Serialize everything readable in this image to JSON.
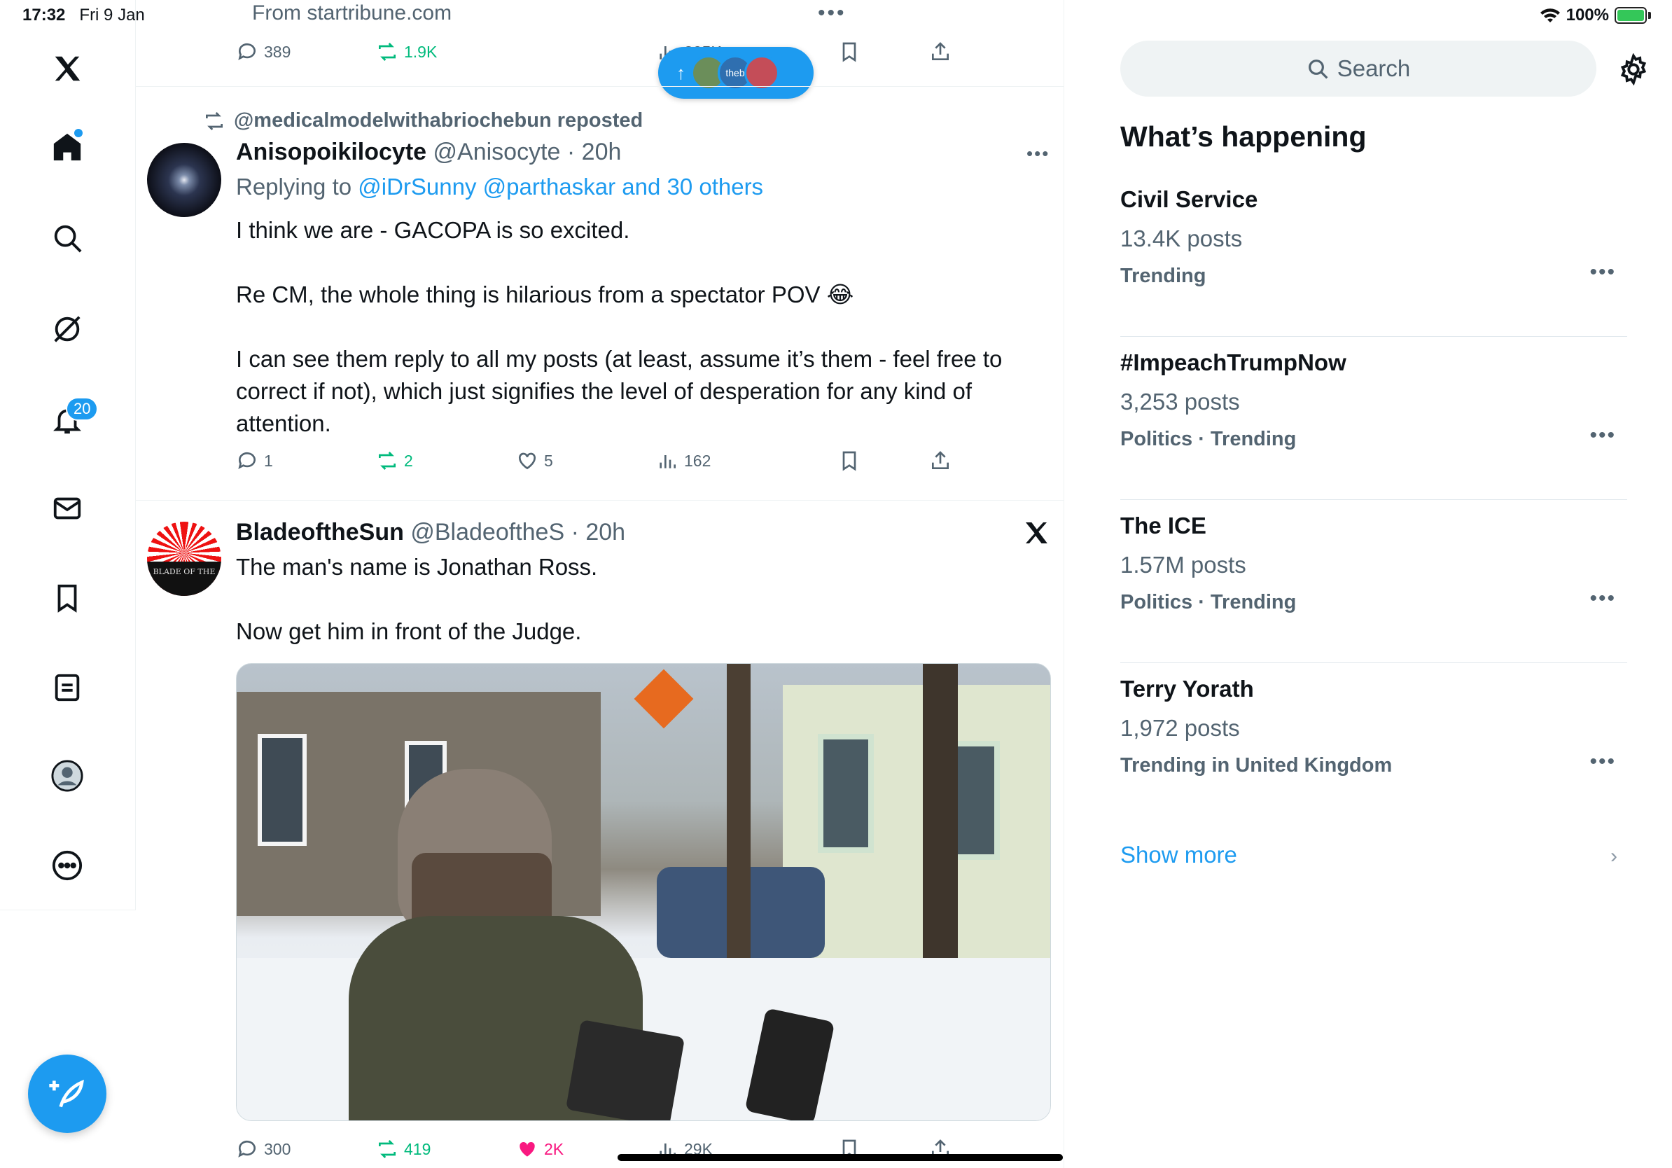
{
  "status_bar": {
    "time": "17:32",
    "date": "Fri 9 Jan",
    "battery": "100%"
  },
  "nav": {
    "notifications_count": "20"
  },
  "feed": {
    "prev_post": {
      "source": "From startribune.com",
      "replies": "389",
      "reposts": "1.9K",
      "views": "805K"
    },
    "new_posts_pill": {
      "arrow": "↑",
      "label": "theb"
    },
    "post1": {
      "repost_label": "@medicalmodelwithabriochebun reposted",
      "display_name": "Anisopoikilocyte",
      "handle": "@Anisocyte",
      "time": "20h",
      "replying_prefix": "Replying to ",
      "replying_mentions": "@iDrSunny @parthaskar and 30 others",
      "text_p1": "I think we are - GACOPA is so excited.",
      "text_p2": "Re CM, the whole thing is hilarious from a spectator POV 😂",
      "text_p3": "I can see them reply to all my posts (at least, assume it’s them - feel free to correct if not), which just signifies the level of desperation for any kind of attention.",
      "replies": "1",
      "reposts": "2",
      "likes": "5",
      "views": "162"
    },
    "post2": {
      "display_name": "BladeoftheSun",
      "handle": "@BladeoftheS",
      "time": "20h",
      "avatar_text": "BLADE OF THE",
      "text_p1": "The man's name is Jonathan Ross.",
      "text_p2": "Now get him in front of the Judge.",
      "replies": "300",
      "reposts": "419",
      "likes": "2K",
      "views": "29K"
    }
  },
  "sidebar": {
    "search_placeholder": "Search",
    "heading": "What’s happening",
    "trends": [
      {
        "title": "Civil Service",
        "count": "13.4K posts",
        "meta": "Trending"
      },
      {
        "title": "#ImpeachTrumpNow",
        "count": "3,253 posts",
        "meta": "Politics · Trending"
      },
      {
        "title": "The ICE",
        "count": "1.57M posts",
        "meta": "Politics · Trending"
      },
      {
        "title": "Terry Yorath",
        "count": "1,972 posts",
        "meta": "Trending in United Kingdom"
      }
    ],
    "more_glyph": "•••",
    "show_more": "Show more"
  },
  "colors": {
    "accent": "#1d9bf0",
    "repost_green": "#00ba7c",
    "like_pink": "#f91880",
    "muted": "#536471"
  }
}
